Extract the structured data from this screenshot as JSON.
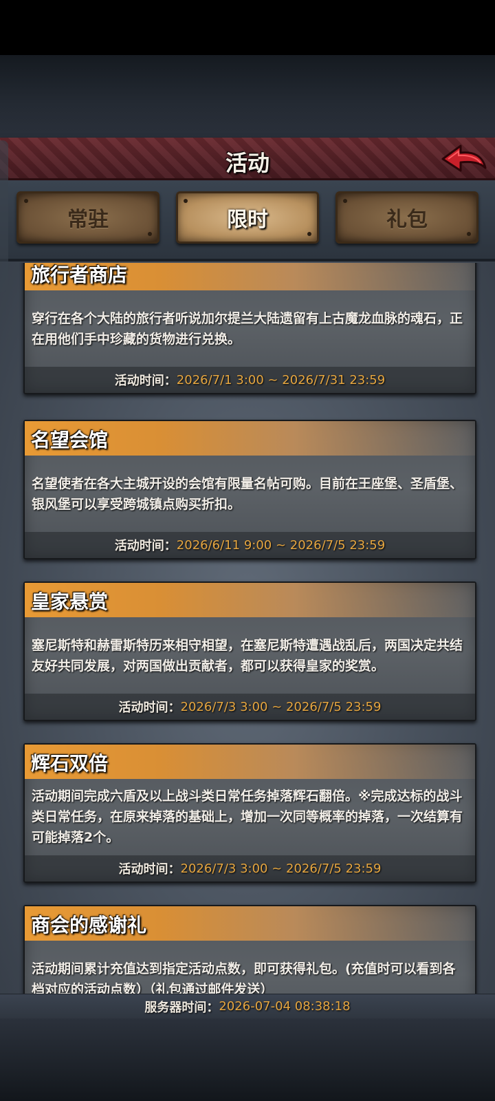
{
  "header": {
    "title": "活动"
  },
  "tabs": [
    {
      "label": "常驻",
      "active": false
    },
    {
      "label": "限时",
      "active": true
    },
    {
      "label": "礼包",
      "active": false
    }
  ],
  "events": [
    {
      "title": "旅行者商店",
      "desc": "穿行在各个大陆的旅行者听说加尔提兰大陆遗留有上古魔龙血脉的魂石，正在用他们手中珍藏的货物进行兑换。",
      "time_label": "活动时间：",
      "time_value": "2026/7/1 3:00 ~ 2026/7/31 23:59"
    },
    {
      "title": "名望会馆",
      "desc": "名望使者在各大主城开设的会馆有限量名帖可购。目前在王座堡、圣盾堡、银风堡可以享受跨城镇点购买折扣。",
      "time_label": "活动时间：",
      "time_value": "2026/6/11 9:00 ~ 2026/7/5 23:59"
    },
    {
      "title": "皇家悬赏",
      "desc": "塞尼斯特和赫雷斯特历来相守相望，在塞尼斯特遭遇战乱后，两国决定共结友好共同发展，对两国做出贡献者，都可以获得皇家的奖赏。",
      "time_label": "活动时间：",
      "time_value": "2026/7/3 3:00 ~ 2026/7/5 23:59"
    },
    {
      "title": "辉石双倍",
      "desc": "活动期间完成六盾及以上战斗类日常任务掉落辉石翻倍。※完成达标的战斗类日常任务，在原来掉落的基础上，增加一次同等概率的掉落，一次结算有可能掉落2个。",
      "time_label": "活动时间：",
      "time_value": "2026/7/3 3:00 ~ 2026/7/5 23:59"
    },
    {
      "title": "商会的感谢礼",
      "desc": "活动期间累计充值达到指定活动点数，即可获得礼包。(充值时可以看到各档对应的活动点数）（礼包通过邮件发送）",
      "time_label": "",
      "time_value": ""
    }
  ],
  "footer": {
    "server_time_label": "服务器时间：",
    "server_time_value": "2026-07-04 08:38:18"
  },
  "colors": {
    "accent_orange": "#e89a35",
    "time_value": "#e6a640",
    "title_bar": "#5a2328"
  },
  "icons": {
    "back": "back-arrow-icon"
  }
}
